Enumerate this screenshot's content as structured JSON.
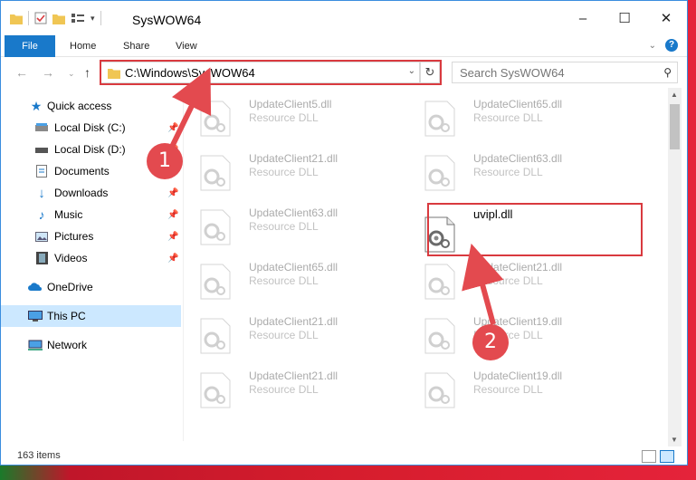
{
  "window": {
    "title": "SysWOW64",
    "controls": {
      "minimize": "–",
      "maximize": "☐",
      "close": "✕"
    }
  },
  "ribbon": {
    "tabs": [
      "File",
      "Home",
      "Share",
      "View"
    ],
    "expand_icon": "chevron-down-icon",
    "help": "?"
  },
  "address_bar": {
    "path": "C:\\Windows\\SysWOW64",
    "search_placeholder": "Search SysWOW64"
  },
  "sidebar": {
    "items": [
      {
        "label": "Quick access",
        "icon": "star-icon",
        "pinned": false
      },
      {
        "label": "Local Disk (C:)",
        "icon": "drive-icon",
        "pinned": true
      },
      {
        "label": "Local Disk (D:)",
        "icon": "drive-icon",
        "pinned": true
      },
      {
        "label": "Documents",
        "icon": "document-icon",
        "pinned": true
      },
      {
        "label": "Downloads",
        "icon": "download-icon",
        "pinned": true
      },
      {
        "label": "Music",
        "icon": "music-icon",
        "pinned": true
      },
      {
        "label": "Pictures",
        "icon": "picture-icon",
        "pinned": true
      },
      {
        "label": "Videos",
        "icon": "video-icon",
        "pinned": true
      },
      {
        "label": "OneDrive",
        "icon": "cloud-icon",
        "pinned": false
      },
      {
        "label": "This PC",
        "icon": "computer-icon",
        "pinned": false,
        "selected": true
      },
      {
        "label": "Network",
        "icon": "network-icon",
        "pinned": false
      }
    ]
  },
  "files": {
    "left_column": [
      {
        "name": "UpdateClient5.dll",
        "type": "Resource DLL"
      },
      {
        "name": "UpdateClient21.dll",
        "type": "Resource DLL"
      },
      {
        "name": "UpdateClient63.dll",
        "type": "Resource DLL"
      },
      {
        "name": "UpdateClient65.dll",
        "type": "Resource DLL"
      },
      {
        "name": "UpdateClient21.dll",
        "type": "Resource DLL"
      },
      {
        "name": "UpdateClient21.dll",
        "type": "Resource DLL"
      }
    ],
    "right_column": [
      {
        "name": "UpdateClient65.dll",
        "type": "Resource DLL"
      },
      {
        "name": "UpdateClient63.dll",
        "type": "Resource DLL"
      },
      {
        "name": "uvipl.dll",
        "type": "",
        "highlighted": true
      },
      {
        "name": "UpdateClient21.dll",
        "type": "Resource DLL"
      },
      {
        "name": "UpdateClient19.dll",
        "type": "Resource DLL"
      },
      {
        "name": "UpdateClient19.dll",
        "type": "Resource DLL"
      }
    ]
  },
  "status": {
    "item_count": "163 items"
  },
  "annotations": {
    "step1": "1",
    "step2": "2",
    "color": "#e34a4f"
  }
}
